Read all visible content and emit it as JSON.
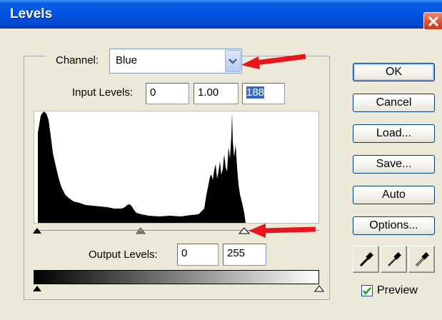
{
  "window": {
    "title": "Levels"
  },
  "channel": {
    "label": "Channel:",
    "value": "Blue"
  },
  "input_levels": {
    "label": "Input Levels:",
    "black": "0",
    "gamma": "1.00",
    "white": "188"
  },
  "output_levels": {
    "label": "Output Levels:",
    "black": "0",
    "white": "255"
  },
  "buttons": {
    "ok": "OK",
    "cancel": "Cancel",
    "load": "Load...",
    "save": "Save...",
    "auto": "Auto",
    "options": "Options..."
  },
  "preview": {
    "label": "Preview",
    "checked": true
  },
  "eyedroppers": [
    "black-point-eyedropper-icon",
    "gray-point-eyedropper-icon",
    "white-point-eyedropper-icon"
  ],
  "annotations": {
    "arrow_color": "#e8161b"
  },
  "colors": {
    "title_bar": "#0054e3",
    "dialog_bg": "#ece9d8",
    "selection": "#316ac5"
  }
}
